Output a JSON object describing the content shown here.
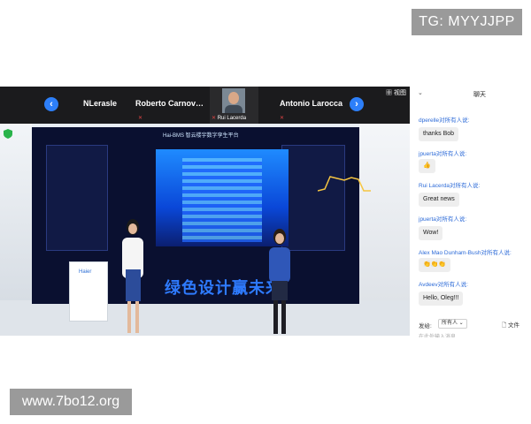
{
  "watermarks": {
    "top": "TG: MYYJJPP",
    "bottom": "www.7bo12.org"
  },
  "participants": {
    "prev_icon": "chevron-left-icon",
    "next_icon": "chevron-right-icon",
    "names": [
      "NLerasle",
      "Roberto  Carnov…",
      "Rui Lacerda",
      "Antonio Larocca"
    ],
    "view_label": "视图"
  },
  "video": {
    "screen_title": "Hai-BMS 智云楼宇数字孪生平台",
    "slogan": "绿色设计赢未来",
    "podium_brand": "Haier"
  },
  "chat": {
    "title": "聊天",
    "messages": [
      {
        "sender": "dperelle对所有人说:",
        "text": "thanks Bob"
      },
      {
        "sender": "jpuerta对所有人说:",
        "text": "👍"
      },
      {
        "sender": "Rui Lacerda对所有人说:",
        "text": "Great news"
      },
      {
        "sender": "jpuerta对所有人说:",
        "text": "Wow!"
      },
      {
        "sender": "Alex Mao Dunham-Bush对所有人说:",
        "text": "👏👏👏"
      },
      {
        "sender": "Avdeev对所有人说:",
        "text": "Hello, Oleg!!!"
      }
    ],
    "send_label": "发给:",
    "send_target": "所有人 ⌄",
    "file_label": "文件",
    "footer_text": "在此处输入消息..."
  },
  "colors": {
    "accent": "#2d7ff9",
    "sender": "#2d6bd8",
    "strip": "#1b1b1d"
  }
}
